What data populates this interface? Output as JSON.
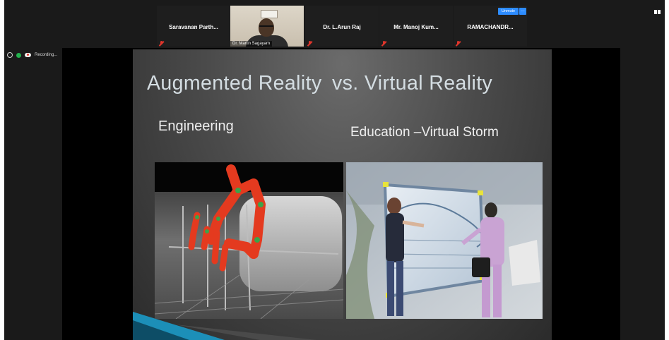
{
  "meeting": {
    "participants": [
      {
        "name": "Saravanan  Parth...",
        "muted": true
      },
      {
        "name": "Dr. Martin Sagayam",
        "video": true,
        "muted": false
      },
      {
        "name": "Dr. L.Arun Raj",
        "muted": true
      },
      {
        "name": "Mr. Manoj Kum...",
        "muted": true
      },
      {
        "name": "RAMACHANDR...",
        "muted": true
      }
    ],
    "unmute_label": "Unmute",
    "more_label": "…",
    "recording_label": "Recording..."
  },
  "slide": {
    "title_left": "Augmented Reality",
    "title_right": "vs. Virtual Reality",
    "label_left": "Engineering",
    "label_right": "Education –Virtual Storm"
  },
  "colors": {
    "accent_blue": "#2d8cff",
    "muted_red": "#e0352b",
    "recording_green": "#23b14d",
    "slide_title": "#d4dde2"
  }
}
